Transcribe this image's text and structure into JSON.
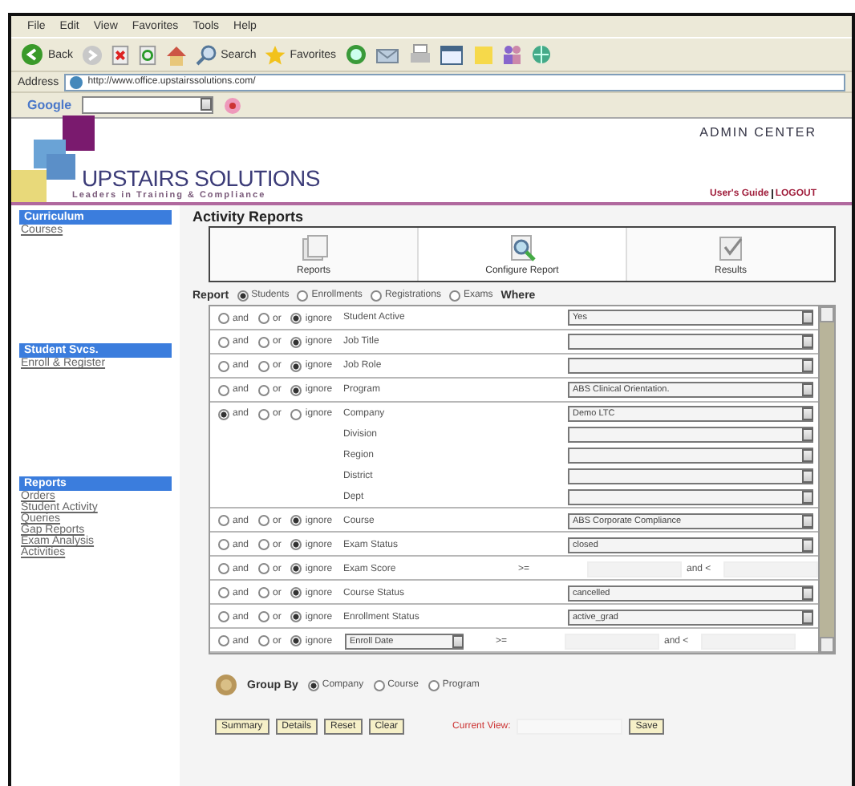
{
  "browser": {
    "menu": [
      "File",
      "Edit",
      "View",
      "Favorites",
      "Tools",
      "Help"
    ],
    "toolbar": {
      "back": "Back",
      "search": "Search",
      "favorites": "Favorites"
    },
    "address_label": "Address",
    "address": "http://www.office.upstairssolutions.com/",
    "google_label": "Google"
  },
  "header": {
    "logo": "UPSTAIRS SOLUTIONS",
    "tagline": "Leaders in Training & Compliance",
    "title": "ADMIN CENTER",
    "links": [
      "User's Guide",
      "LOGOUT"
    ]
  },
  "sidebar": [
    {
      "title": "Curriculum",
      "items": [
        "Courses"
      ]
    },
    {
      "title": "Student Svcs.",
      "items": [
        "Enroll & Register"
      ]
    },
    {
      "title": "Reports",
      "items": [
        "Orders",
        "Student Activity",
        "Queries",
        "Gap Reports",
        "Exam Analysis",
        "Activities"
      ]
    }
  ],
  "page_title": "Activity Reports",
  "tabs": [
    {
      "label": "Reports",
      "kind": "reports",
      "selected": false
    },
    {
      "label": "Configure Report",
      "kind": "configure",
      "selected": true
    },
    {
      "label": "Results",
      "kind": "results",
      "selected": false
    }
  ],
  "report": {
    "label": "Report",
    "options": [
      {
        "label": "Students",
        "selected": true
      },
      {
        "label": "Enrollments",
        "selected": false
      },
      {
        "label": "Registrations",
        "selected": false
      },
      {
        "label": "Exams",
        "selected": false
      }
    ],
    "where": "Where"
  },
  "filters": [
    {
      "kind": "select",
      "modes": [
        {
          "label": "and",
          "selected": false
        },
        {
          "label": "or",
          "selected": false
        },
        {
          "label": "ignore",
          "selected": true
        }
      ],
      "fields": [
        {
          "label": "Student Active",
          "value": "Yes"
        }
      ]
    },
    {
      "kind": "select",
      "modes": [
        {
          "label": "and",
          "selected": false
        },
        {
          "label": "or",
          "selected": false
        },
        {
          "label": "ignore",
          "selected": true
        }
      ],
      "fields": [
        {
          "label": "Job Title"
        }
      ]
    },
    {
      "kind": "select",
      "modes": [
        {
          "label": "and",
          "selected": false
        },
        {
          "label": "or",
          "selected": false
        },
        {
          "label": "ignore",
          "selected": true
        }
      ],
      "fields": [
        {
          "label": "Job Role"
        }
      ]
    },
    {
      "kind": "select",
      "modes": [
        {
          "label": "and",
          "selected": false
        },
        {
          "label": "or",
          "selected": false
        },
        {
          "label": "ignore",
          "selected": true
        }
      ],
      "fields": [
        {
          "label": "Program",
          "value": "ABS Clinical Orientation."
        }
      ]
    },
    {
      "kind": "select",
      "modes": [
        {
          "label": "and",
          "selected": true
        },
        {
          "label": "or",
          "selected": false
        },
        {
          "label": "ignore",
          "selected": false
        }
      ],
      "fields": [
        {
          "label": "Company",
          "value": "Demo LTC"
        },
        {
          "label": "Division"
        },
        {
          "label": "Region"
        },
        {
          "label": "District"
        },
        {
          "label": "Dept"
        }
      ]
    },
    {
      "kind": "select",
      "modes": [
        {
          "label": "and",
          "selected": false
        },
        {
          "label": "or",
          "selected": false
        },
        {
          "label": "ignore",
          "selected": true
        }
      ],
      "fields": [
        {
          "label": "Course",
          "value": "ABS Corporate Compliance"
        }
      ]
    },
    {
      "kind": "select",
      "modes": [
        {
          "label": "and",
          "selected": false
        },
        {
          "label": "or",
          "selected": false
        },
        {
          "label": "ignore",
          "selected": true
        }
      ],
      "fields": [
        {
          "label": "Exam Status",
          "value": "closed"
        }
      ]
    },
    {
      "kind": "range",
      "modes": [
        {
          "label": "and",
          "selected": false
        },
        {
          "label": "or",
          "selected": false
        },
        {
          "label": "ignore",
          "selected": true
        }
      ],
      "fields": [
        {
          "label": "Exam Score"
        }
      ],
      "from": ">=",
      "to": "and <"
    },
    {
      "kind": "select",
      "modes": [
        {
          "label": "and",
          "selected": false
        },
        {
          "label": "or",
          "selected": false
        },
        {
          "label": "ignore",
          "selected": true
        }
      ],
      "fields": [
        {
          "label": "Course Status",
          "value": "cancelled"
        }
      ]
    },
    {
      "kind": "select",
      "modes": [
        {
          "label": "and",
          "selected": false
        },
        {
          "label": "or",
          "selected": false
        },
        {
          "label": "ignore",
          "selected": true
        }
      ],
      "fields": [
        {
          "label": "Enrollment Status",
          "value": "active_grad"
        }
      ]
    },
    {
      "kind": "date_range",
      "modes": [
        {
          "label": "and",
          "selected": false
        },
        {
          "label": "or",
          "selected": false
        },
        {
          "label": "ignore",
          "selected": true
        }
      ],
      "fields": [
        {
          "label": "Enroll Date"
        }
      ],
      "from": ">=",
      "to": "and <"
    }
  ],
  "group_by": {
    "label": "Group By",
    "options": [
      {
        "label": "Company",
        "selected": true
      },
      {
        "label": "Course",
        "selected": false
      },
      {
        "label": "Program",
        "selected": false
      }
    ]
  },
  "buttons": [
    "Summary",
    "Details",
    "Reset",
    "Clear"
  ],
  "current_view": {
    "label": "Current View:",
    "save": "Save"
  }
}
